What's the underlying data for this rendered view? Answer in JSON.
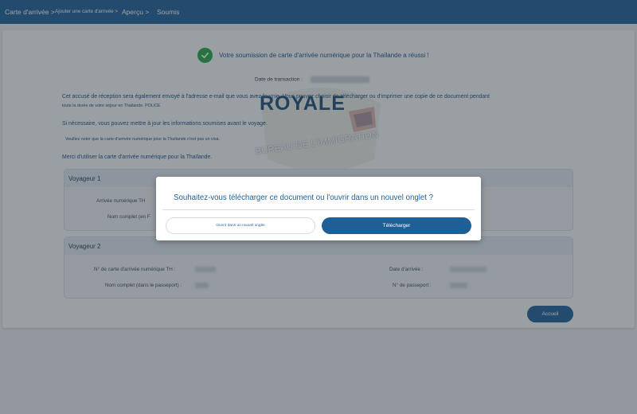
{
  "nav": {
    "crumbs": [
      {
        "label": "Carte d'arrivée >"
      },
      {
        "label": "Ajouter une carte d'arrivée >"
      },
      {
        "label": "Aperçu >"
      },
      {
        "label": "Soumis"
      }
    ]
  },
  "main": {
    "success_message": "Votre soumission de carte d'arrivée numérique pour la Thaïlande a réussi !",
    "transaction_label": "Date de transaction :",
    "email_notice_line1": "Cet accusé de réception sera également envoyé à l'adresse e-mail que vous avez fournie. Vous pouvez choisir de télécharger ou d'imprimer une copie de ce document pendant",
    "email_notice_line2": "toute la durée de votre séjour en Thaïlande. POLICE",
    "update_notice": "Si nécessaire, vous pouvez mettre à jour les informations soumises avant le voyage.",
    "visa_notice": "Veuillez noter que la carte d'arrivée numérique pour la Thaïlande n'est pas un visa.",
    "thanks": "Merci d'utiliser la carte d'arrivée numérique pour la Thaïlande.",
    "watermark_title": "ROYALE",
    "watermark_subtitle": "BUREAU DE L'IMMIGRATION"
  },
  "travellers": [
    {
      "title": "Voyageur 1",
      "card_label": "Arrivée numérique TH",
      "name_label": "Nom complet (en F"
    },
    {
      "title": "Voyageur 2",
      "card_label": "N° de carte d'arrivée numérique TH :",
      "name_label": "Nom complet (dans le passeport) :",
      "arrival_label": "Date d'arrivée :",
      "passport_label": "N° de passeport :"
    }
  ],
  "home_button": "Accueil",
  "modal": {
    "title": "Souhaitez-vous télécharger ce document ou l'ouvrir dans un nouvel onglet ?",
    "open_button": "Ouvrir dans un nouvel onglet",
    "download_button": "Télécharger"
  },
  "colors": {
    "primary": "#1f5f97",
    "success": "#28a745"
  }
}
